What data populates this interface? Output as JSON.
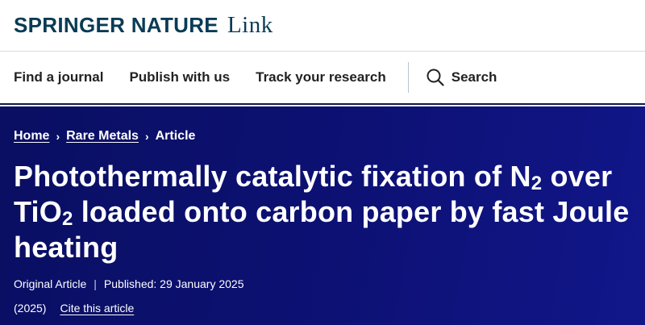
{
  "brand": {
    "name": "SPRINGER NATURE",
    "product": "Link"
  },
  "nav": {
    "items": [
      {
        "label": "Find a journal"
      },
      {
        "label": "Publish with us"
      },
      {
        "label": "Track your research"
      }
    ],
    "search_label": "Search",
    "search_icon": "search-icon"
  },
  "breadcrumb": {
    "items": [
      {
        "label": "Home"
      },
      {
        "label": "Rare Metals"
      }
    ],
    "current": "Article",
    "separator": "›"
  },
  "article": {
    "title_parts": {
      "p1": "Photothermally catalytic fixation of N",
      "sub1": "2",
      "p2": " over TiO",
      "sub2": "2",
      "p3": " loaded onto carbon paper by fast Joule heating"
    },
    "type": "Original Article",
    "published": "Published: 29 January 2025",
    "year": "(2025)",
    "cite_label": "Cite this article"
  },
  "colors": {
    "brand": "#0a3b55",
    "hero_bg": "#0c1070",
    "nav_text": "#222222"
  }
}
